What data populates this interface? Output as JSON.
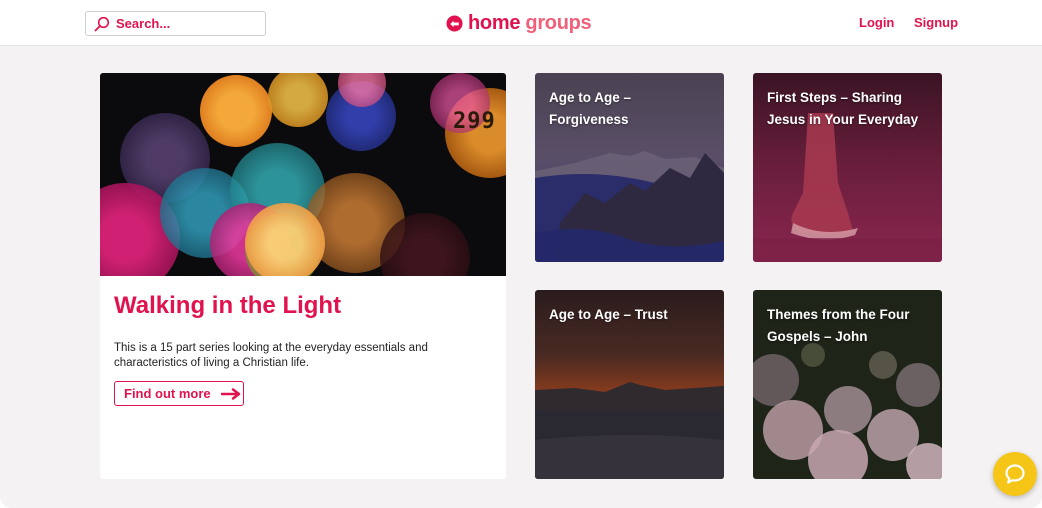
{
  "header": {
    "search_placeholder": "Search...",
    "logo_word1": "home",
    "logo_word2": "groups",
    "login": "Login",
    "signup": "Signup"
  },
  "feature": {
    "title": "Walking in the Light",
    "description": "This is a 15 part series looking at the everyday essentials and characteristics of living a Christian life.",
    "button_label": "Find out more",
    "image_text": "299"
  },
  "cards": [
    {
      "title": "Age to Age – Forgiveness"
    },
    {
      "title": "First Steps – Sharing Jesus in Your Everyday"
    },
    {
      "title": "Age to Age – Trust"
    },
    {
      "title": "Themes from the Four Gospels – John"
    }
  ],
  "icons": {
    "search": "search-icon",
    "logo": "logo-icon",
    "arrow": "arrow-right-icon",
    "chat": "chat-icon"
  },
  "colors": {
    "brand": "#e0134e",
    "brand_light": "#f0607a",
    "background": "#f4f2f3",
    "chat_button": "#f5c518"
  }
}
